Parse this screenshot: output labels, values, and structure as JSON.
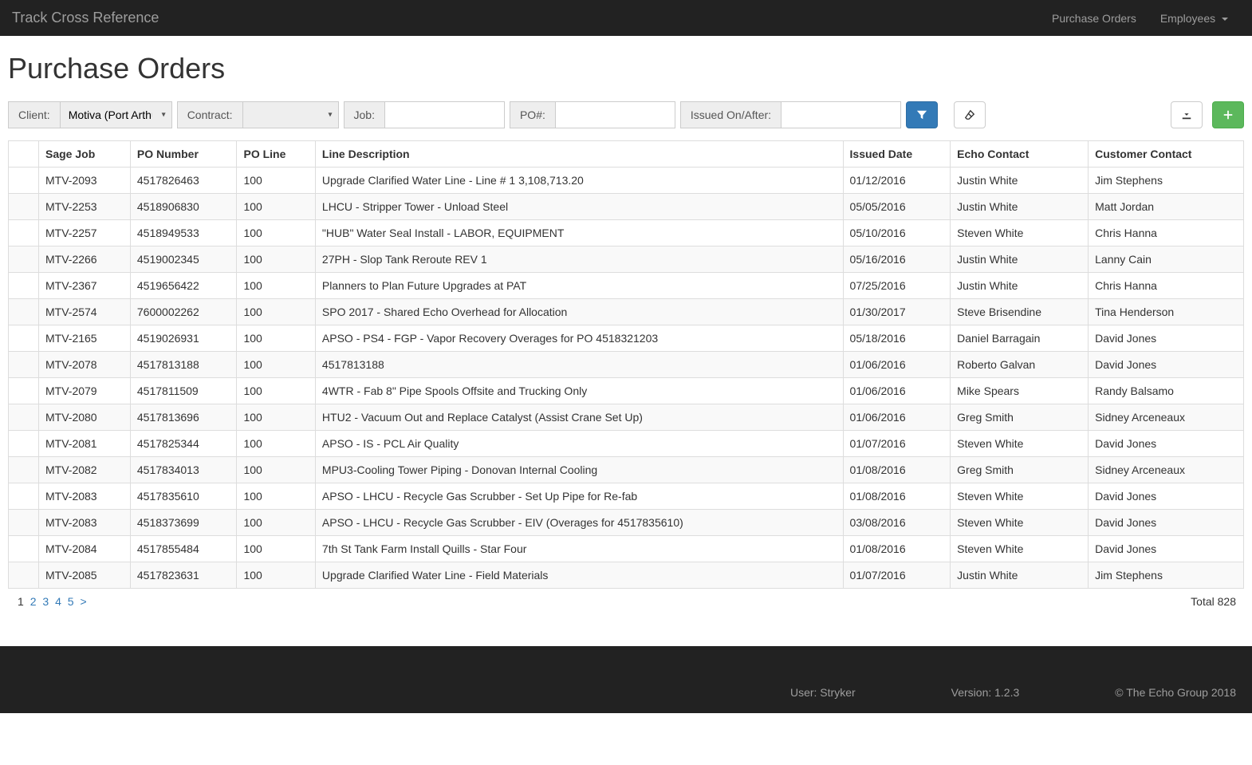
{
  "navbar": {
    "brand": "Track Cross Reference",
    "links": {
      "purchase_orders": "Purchase Orders",
      "employees": "Employees"
    }
  },
  "page": {
    "title": "Purchase Orders"
  },
  "filters": {
    "client_label": "Client:",
    "client_value": "Motiva (Port Arthur",
    "contract_label": "Contract:",
    "contract_value": "",
    "job_label": "Job:",
    "job_value": "",
    "po_label": "PO#:",
    "po_value": "",
    "issued_label": "Issued On/After:",
    "issued_value": ""
  },
  "table": {
    "headers": {
      "sage_job": "Sage Job",
      "po_number": "PO Number",
      "po_line": "PO Line",
      "line_desc": "Line Description",
      "issued_date": "Issued Date",
      "echo_contact": "Echo Contact",
      "customer_contact": "Customer Contact"
    },
    "rows": [
      {
        "sage_job": "MTV-2093",
        "po_number": "4517826463",
        "po_line": "100",
        "line_desc": "Upgrade Clarified Water Line - Line # 1 3,108,713.20",
        "issued_date": "01/12/2016",
        "echo_contact": "Justin White",
        "customer_contact": "Jim Stephens"
      },
      {
        "sage_job": "MTV-2253",
        "po_number": "4518906830",
        "po_line": "100",
        "line_desc": "LHCU - Stripper Tower - Unload Steel",
        "issued_date": "05/05/2016",
        "echo_contact": "Justin White",
        "customer_contact": "Matt Jordan"
      },
      {
        "sage_job": "MTV-2257",
        "po_number": "4518949533",
        "po_line": "100",
        "line_desc": "\"HUB\" Water Seal Install - LABOR, EQUIPMENT",
        "issued_date": "05/10/2016",
        "echo_contact": "Steven White",
        "customer_contact": "Chris Hanna"
      },
      {
        "sage_job": "MTV-2266",
        "po_number": "4519002345",
        "po_line": "100",
        "line_desc": "27PH - Slop Tank Reroute REV 1",
        "issued_date": "05/16/2016",
        "echo_contact": "Justin White",
        "customer_contact": "Lanny Cain"
      },
      {
        "sage_job": "MTV-2367",
        "po_number": "4519656422",
        "po_line": "100",
        "line_desc": "Planners to Plan Future Upgrades at PAT",
        "issued_date": "07/25/2016",
        "echo_contact": "Justin White",
        "customer_contact": "Chris Hanna"
      },
      {
        "sage_job": "MTV-2574",
        "po_number": "7600002262",
        "po_line": "100",
        "line_desc": "SPO 2017 - Shared Echo Overhead for Allocation",
        "issued_date": "01/30/2017",
        "echo_contact": "Steve Brisendine",
        "customer_contact": "Tina Henderson"
      },
      {
        "sage_job": "MTV-2165",
        "po_number": "4519026931",
        "po_line": "100",
        "line_desc": "APSO - PS4 - FGP - Vapor Recovery Overages for PO 4518321203",
        "issued_date": "05/18/2016",
        "echo_contact": "Daniel Barragain",
        "customer_contact": "David Jones"
      },
      {
        "sage_job": "MTV-2078",
        "po_number": "4517813188",
        "po_line": "100",
        "line_desc": "4517813188",
        "issued_date": "01/06/2016",
        "echo_contact": "Roberto Galvan",
        "customer_contact": "David Jones"
      },
      {
        "sage_job": "MTV-2079",
        "po_number": "4517811509",
        "po_line": "100",
        "line_desc": "4WTR - Fab 8\" Pipe Spools Offsite and Trucking Only",
        "issued_date": "01/06/2016",
        "echo_contact": "Mike Spears",
        "customer_contact": "Randy Balsamo"
      },
      {
        "sage_job": "MTV-2080",
        "po_number": "4517813696",
        "po_line": "100",
        "line_desc": "HTU2 - Vacuum Out and Replace Catalyst (Assist Crane Set Up)",
        "issued_date": "01/06/2016",
        "echo_contact": "Greg Smith",
        "customer_contact": "Sidney Arceneaux"
      },
      {
        "sage_job": "MTV-2081",
        "po_number": "4517825344",
        "po_line": "100",
        "line_desc": "APSO - IS - PCL Air Quality",
        "issued_date": "01/07/2016",
        "echo_contact": "Steven White",
        "customer_contact": "David Jones"
      },
      {
        "sage_job": "MTV-2082",
        "po_number": "4517834013",
        "po_line": "100",
        "line_desc": "MPU3-Cooling Tower Piping - Donovan Internal Cooling",
        "issued_date": "01/08/2016",
        "echo_contact": "Greg Smith",
        "customer_contact": "Sidney Arceneaux"
      },
      {
        "sage_job": "MTV-2083",
        "po_number": "4517835610",
        "po_line": "100",
        "line_desc": "APSO - LHCU - Recycle Gas Scrubber - Set Up Pipe for Re-fab",
        "issued_date": "01/08/2016",
        "echo_contact": "Steven White",
        "customer_contact": "David Jones"
      },
      {
        "sage_job": "MTV-2083",
        "po_number": "4518373699",
        "po_line": "100",
        "line_desc": "APSO - LHCU - Recycle Gas Scrubber - EIV (Overages for 4517835610)",
        "issued_date": "03/08/2016",
        "echo_contact": "Steven White",
        "customer_contact": "David Jones"
      },
      {
        "sage_job": "MTV-2084",
        "po_number": "4517855484",
        "po_line": "100",
        "line_desc": "7th St Tank Farm Install Quills - Star Four",
        "issued_date": "01/08/2016",
        "echo_contact": "Steven White",
        "customer_contact": "David Jones"
      },
      {
        "sage_job": "MTV-2085",
        "po_number": "4517823631",
        "po_line": "100",
        "line_desc": "Upgrade Clarified Water Line - Field Materials",
        "issued_date": "01/07/2016",
        "echo_contact": "Justin White",
        "customer_contact": "Jim Stephens"
      }
    ]
  },
  "pagination": {
    "pages": [
      "1",
      "2",
      "3",
      "4",
      "5"
    ],
    "next": ">",
    "total_label": "Total 828"
  },
  "footer": {
    "user": "User: Stryker",
    "version": "Version: 1.2.3",
    "copyright": "© The Echo Group 2018"
  }
}
